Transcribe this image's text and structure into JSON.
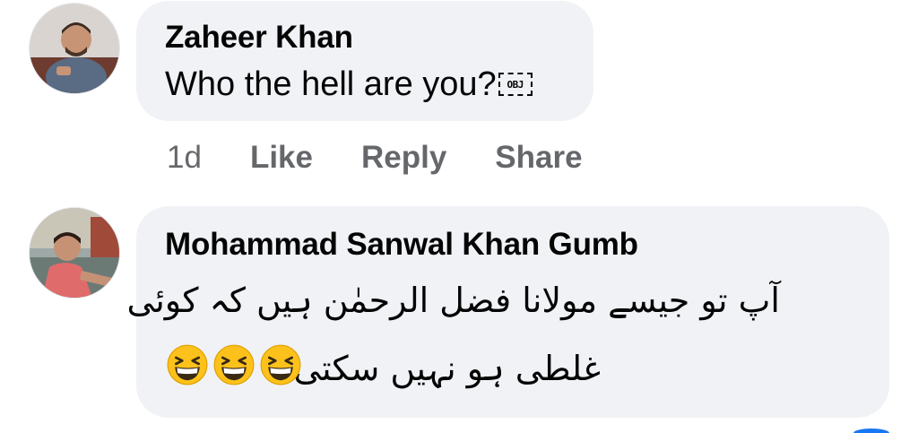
{
  "comments": [
    {
      "author": "Zaheer Khan",
      "text": "Who the hell are you?",
      "attachment_marker": "OBJ",
      "time": "1d",
      "actions": [
        "Like",
        "Reply",
        "Share"
      ]
    },
    {
      "author": "Mohammad Sanwal Khan Gumb",
      "text_line_1": "آپ تو جیسے مولانا فضل الرحمٰن ہیں کہ کوئی",
      "text_line_2": "غلطی ہو نہیں سکتی",
      "emojis": [
        "grinning-squinting-face",
        "grinning-squinting-face",
        "grinning-squinting-face"
      ]
    }
  ],
  "colors": {
    "bubble": "#f0f2f5",
    "text": "#050505",
    "secondary": "#65676b",
    "accent": "#1877f2"
  }
}
